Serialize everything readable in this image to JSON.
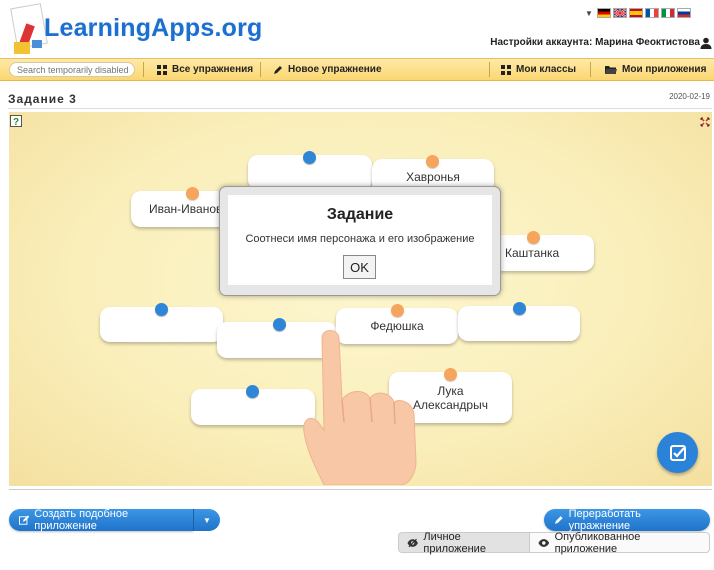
{
  "header": {
    "logo": "LearningApps.org",
    "account_label": "Настройки аккаунта: Марина Феоктистова"
  },
  "flags": [
    "de",
    "en",
    "es",
    "fr",
    "it",
    "ru"
  ],
  "toolbar": {
    "search_placeholder": "Search temporarily disabled",
    "all_exercises": "Все упражнения",
    "new_exercise": "Новое упражнение",
    "my_classes": "Мои классы",
    "my_apps": "Мои приложения"
  },
  "page": {
    "title": "Задание 3",
    "date": "2020-02-19"
  },
  "cards": [
    {
      "label": ""
    },
    {
      "label": "Хавронья"
    },
    {
      "label": "Иван-Иванов"
    },
    {
      "label": "Каштанка"
    },
    {
      "label": ""
    },
    {
      "label": ""
    },
    {
      "label": "Федюшка"
    },
    {
      "label": ""
    },
    {
      "label": ""
    },
    {
      "label": "Лука Александрыч"
    }
  ],
  "modal": {
    "title": "Задание",
    "text": "Соотнеси имя персонажа и его изображение",
    "ok": "OK"
  },
  "bottom": {
    "create_similar": "Создать подобное приложение",
    "rework": "Переработать упражнение",
    "private_app": "Личное приложение",
    "published_app": "Опубликованное приложение"
  },
  "colors": {
    "accent_blue": "#2b82d9",
    "toolbar_yellow": "#fbd772",
    "dot_orange": "#f7a45c"
  },
  "icons": {
    "check": "check-square-icon",
    "help": "help-icon",
    "fullscreen": "fullscreen-icon",
    "user": "user-icon"
  }
}
